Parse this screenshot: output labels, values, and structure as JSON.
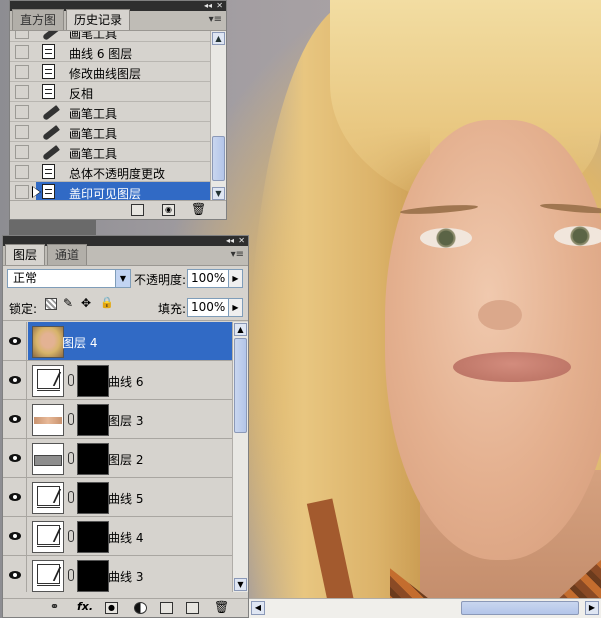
{
  "history_panel": {
    "tabs": [
      "直方图",
      "历史记录"
    ],
    "active_tab": 1,
    "items": [
      {
        "label": "画笔工具",
        "icon": "brush-icon",
        "selected": false
      },
      {
        "label": "曲线 6 图层",
        "icon": "document-icon",
        "selected": false
      },
      {
        "label": "修改曲线图层",
        "icon": "document-icon",
        "selected": false
      },
      {
        "label": "反相",
        "icon": "document-icon",
        "selected": false
      },
      {
        "label": "画笔工具",
        "icon": "brush-icon",
        "selected": false
      },
      {
        "label": "画笔工具",
        "icon": "brush-icon",
        "selected": false
      },
      {
        "label": "画笔工具",
        "icon": "brush-icon",
        "selected": false
      },
      {
        "label": "总体不透明度更改",
        "icon": "document-icon",
        "selected": false
      },
      {
        "label": "盖印可见图层",
        "icon": "document-icon",
        "selected": true
      }
    ],
    "footer_icons": [
      "new-document-from-state-icon",
      "snapshot-icon",
      "delete-state-icon"
    ]
  },
  "layers_panel": {
    "tabs": [
      "图层",
      "通道"
    ],
    "active_tab": 0,
    "blend_mode": "正常",
    "opacity_label": "不透明度:",
    "opacity_value": "100%",
    "lock_label": "锁定:",
    "fill_label": "填充:",
    "fill_value": "100%",
    "layers": [
      {
        "name": "图层 4",
        "thumb": "photo",
        "mask": false,
        "selected": true,
        "visible": true
      },
      {
        "name": "曲线 6",
        "thumb": "curves",
        "mask": true,
        "selected": false,
        "visible": true
      },
      {
        "name": "图层 3",
        "thumb": "eyes",
        "mask": true,
        "selected": false,
        "visible": true
      },
      {
        "name": "图层 2",
        "thumb": "gray",
        "mask": true,
        "selected": false,
        "visible": true
      },
      {
        "name": "曲线 5",
        "thumb": "curves",
        "mask": true,
        "selected": false,
        "visible": true
      },
      {
        "name": "曲线 4",
        "thumb": "curves",
        "mask": true,
        "selected": false,
        "visible": true
      },
      {
        "name": "曲线 3",
        "thumb": "curves",
        "mask": true,
        "selected": false,
        "visible": true
      }
    ],
    "footer_icons": [
      "link-layers-icon",
      "fx-icon",
      "add-mask-icon",
      "adjustment-layer-icon",
      "new-group-icon",
      "new-layer-icon",
      "delete-layer-icon"
    ],
    "fx_text": "fx."
  },
  "colors": {
    "selection": "#316ac5",
    "panel_bg": "#d6d3ce",
    "titlebar": "#2e2e2e"
  }
}
